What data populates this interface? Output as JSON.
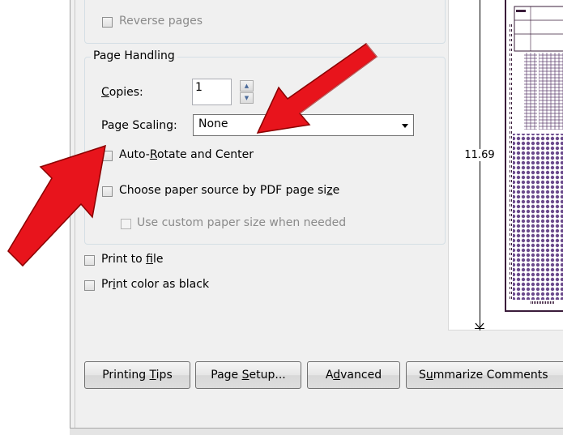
{
  "print_options": {
    "reverse_pages": {
      "label": "Reverse pages",
      "checked": false
    }
  },
  "page_handling": {
    "legend": "Page Handling",
    "copies": {
      "label_pre": "",
      "label_mnemonic": "C",
      "label_post": "opies:",
      "value": "1"
    },
    "page_scaling": {
      "label": "Page Scaling:",
      "selected": "None"
    },
    "auto_rotate": {
      "label_pre": "Auto-",
      "label_mnemonic": "R",
      "label_post": "otate and Center",
      "checked": false
    },
    "paper_source": {
      "label_pre": "Choose paper source by PDF page si",
      "label_mnemonic": "z",
      "label_post": "e",
      "checked": false
    },
    "custom_paper": {
      "label": "Use custom paper size when needed",
      "checked": false,
      "disabled": true
    }
  },
  "print_to_file": {
    "label_pre": "Print to ",
    "label_mnemonic": "f",
    "label_post": "ile",
    "checked": false
  },
  "print_color_as_black": {
    "label_pre": "Pr",
    "label_mnemonic": "i",
    "label_post": "nt color as black",
    "checked": false
  },
  "preview": {
    "height_label": "11.69"
  },
  "buttons": {
    "printing_tips": {
      "pre": "Printing ",
      "mnemonic": "T",
      "post": "ips"
    },
    "page_setup": {
      "pre": "Page ",
      "mnemonic": "S",
      "post": "etup..."
    },
    "advanced": {
      "pre": "A",
      "mnemonic": "d",
      "post": "vanced"
    },
    "summarize_comments": {
      "pre": "S",
      "mnemonic": "u",
      "post": "mmarize Comments"
    }
  },
  "colors": {
    "arrow_red": "#e8141c",
    "accent_purple": "#6b4a8c"
  }
}
